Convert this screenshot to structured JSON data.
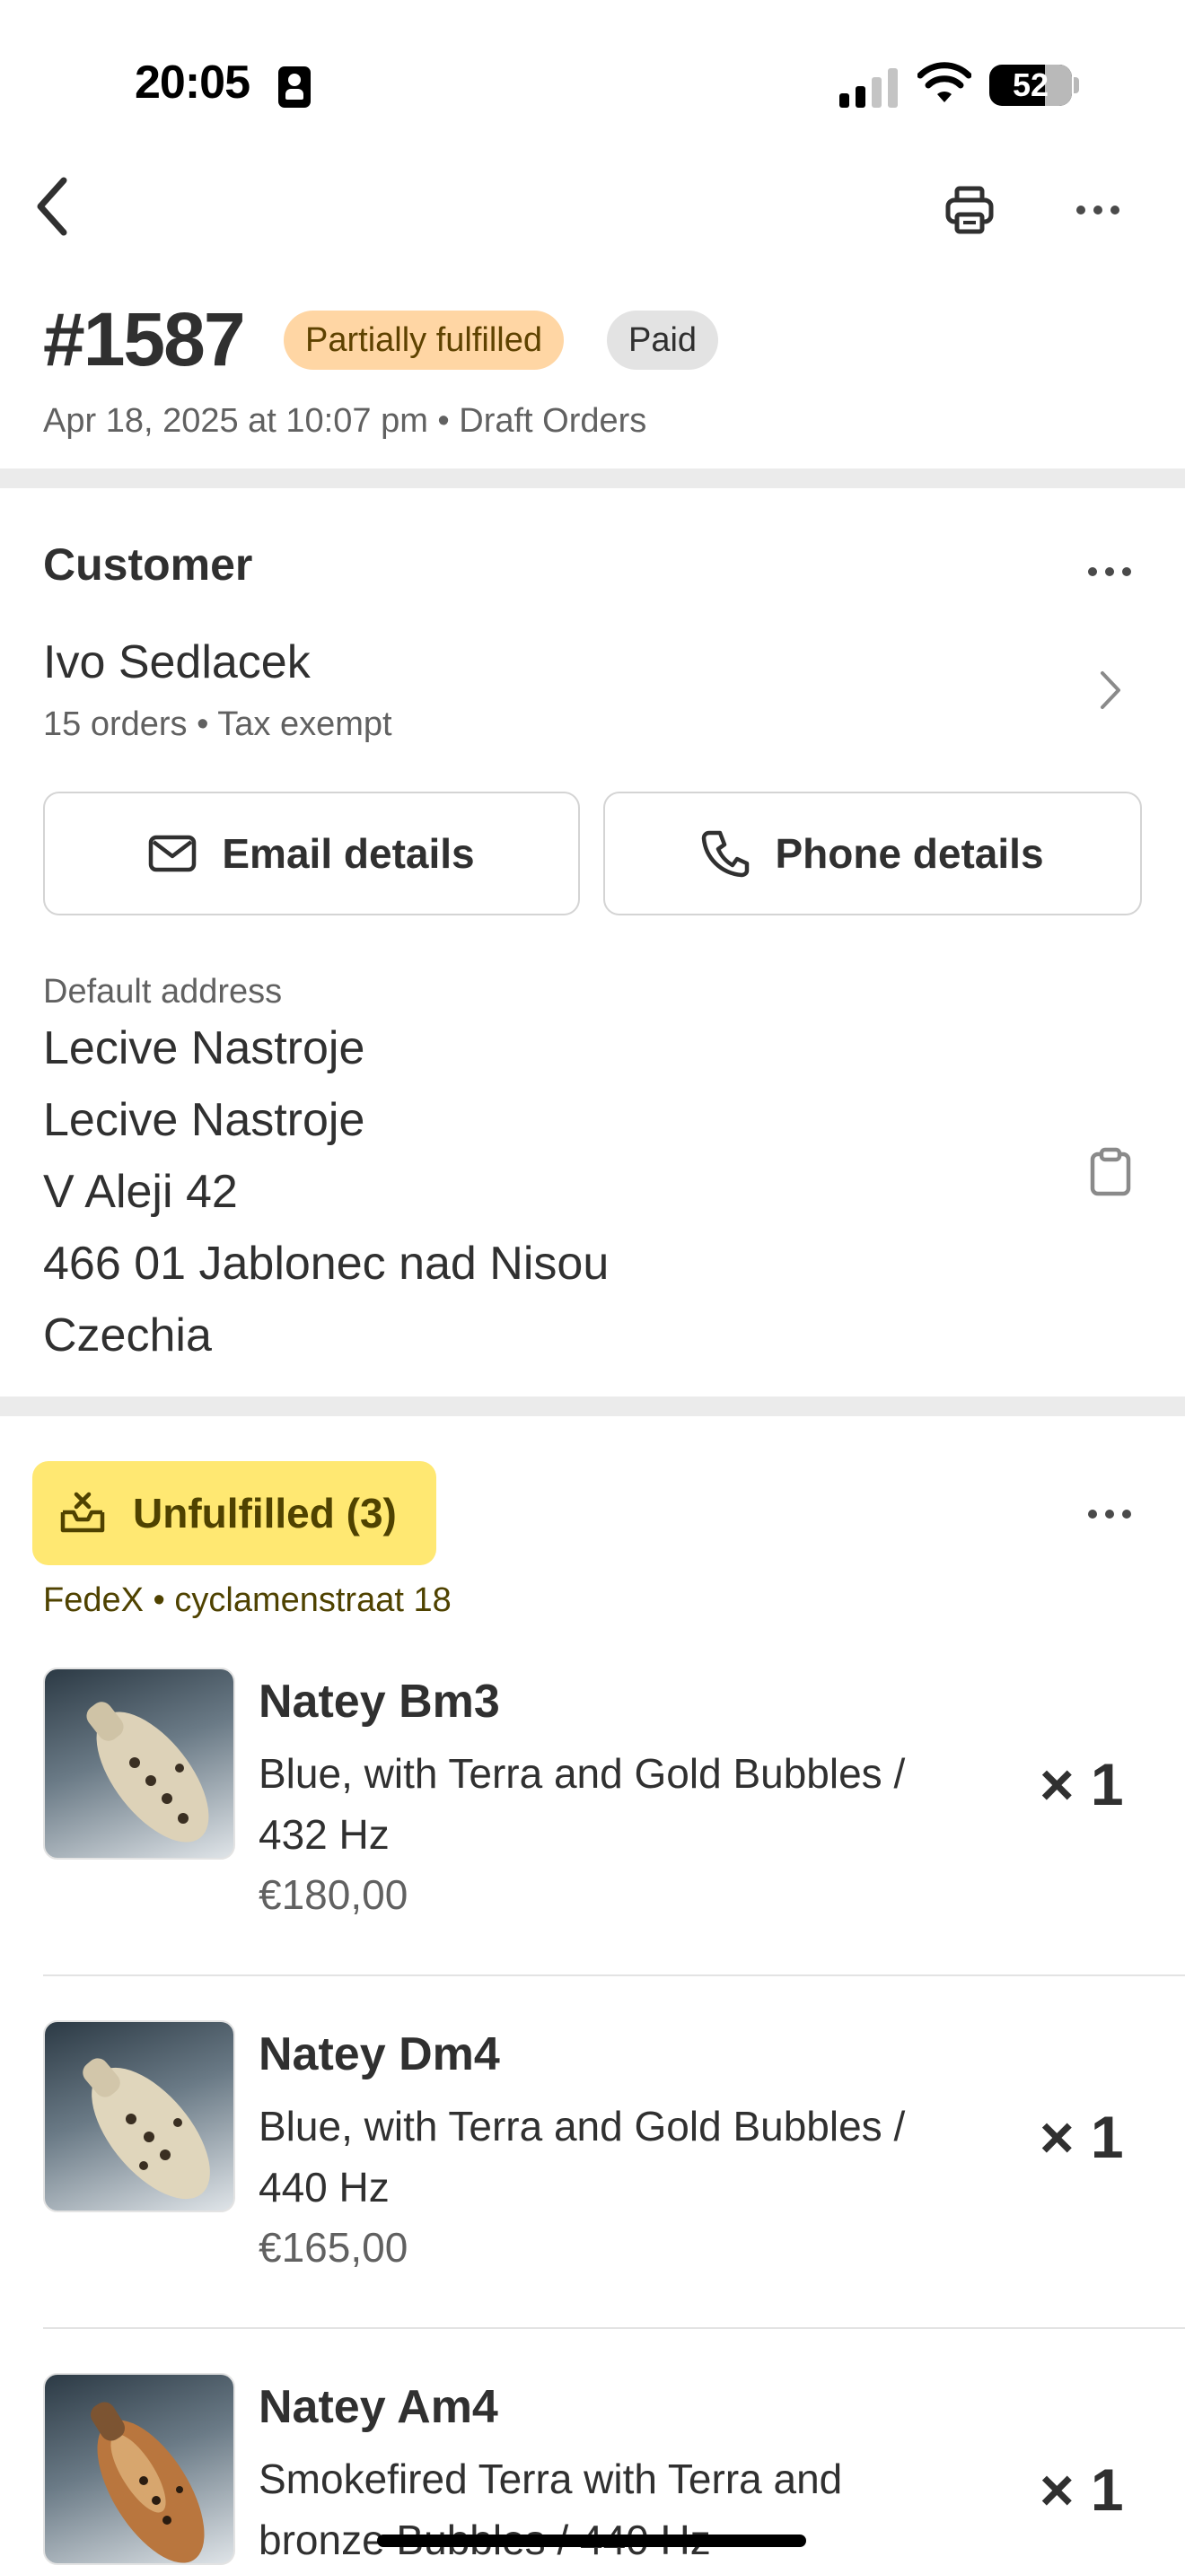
{
  "status_bar": {
    "time": "20:05",
    "battery": "52"
  },
  "order": {
    "number": "#1587",
    "fulfillment_status": "Partially fulfilled",
    "payment_status": "Paid",
    "meta": "Apr 18, 2025 at 10:07 pm • Draft Orders"
  },
  "customer": {
    "section_title": "Customer",
    "name": "Ivo Sedlacek",
    "summary": "15 orders • Tax exempt",
    "email_button": "Email details",
    "phone_button": "Phone details",
    "address_label": "Default address",
    "address_lines": [
      "Lecive Nastroje",
      "Lecive Nastroje",
      "V Aleji 42",
      "466 01 Jablonec nad Nisou",
      "Czechia"
    ]
  },
  "fulfillment": {
    "status_label": "Unfulfilled (3)",
    "shipping": "FedeX • cyclamenstraat 18",
    "items": [
      {
        "title": "Natey Bm3",
        "variant": "Blue, with Terra and Gold Bubbles / 432 Hz",
        "price": "€180,00",
        "qty": "× 1"
      },
      {
        "title": "Natey Dm4",
        "variant": "Blue, with Terra and Gold Bubbles / 440 Hz",
        "price": "€165,00",
        "qty": "× 1"
      },
      {
        "title": "Natey Am4",
        "variant": "Smokefired Terra with Terra and bronze Bubbles / 440 Hz",
        "price": "",
        "qty": "× 1"
      }
    ]
  },
  "icons": {
    "back": "chevron-left-icon",
    "print": "printer-icon",
    "more": "more-horizontal-icon",
    "email": "envelope-icon",
    "phone": "phone-icon",
    "copy": "clipboard-icon",
    "unfulfilled": "inbox-x-icon"
  },
  "colors": {
    "partial_badge": "#ffd6a4",
    "paid_badge": "#e3e3e3",
    "unfulfilled_badge": "#ffe872",
    "section_gap": "#ebebeb"
  }
}
